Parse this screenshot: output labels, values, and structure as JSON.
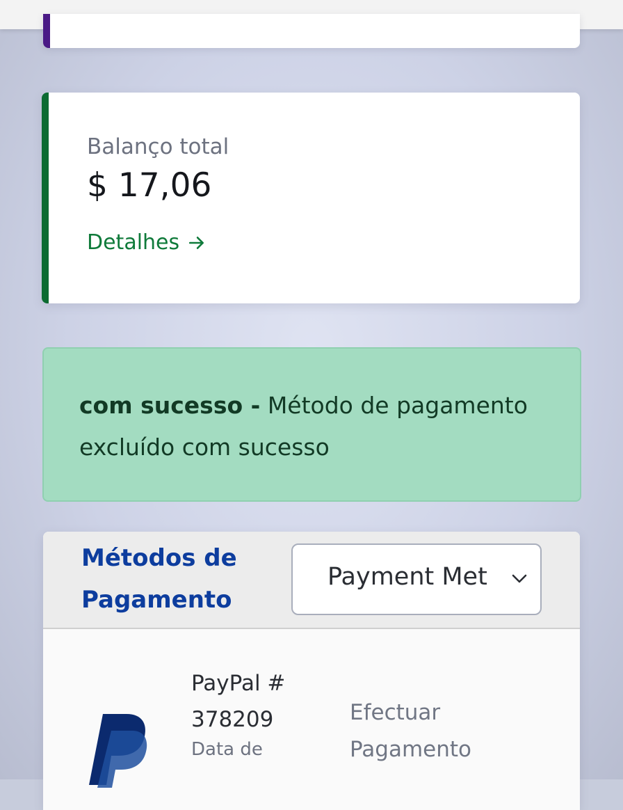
{
  "balance": {
    "label": "Balanço total",
    "amount": "$ 17,06",
    "details_link": "Detalhes"
  },
  "alert": {
    "title": "com sucesso -",
    "message": " Método de pagamento excluído com sucesso"
  },
  "payment_methods": {
    "title": "Métodos de Pagamento",
    "select_value": "Payment Methods",
    "items": [
      {
        "name": "PayPal # 378209",
        "date_label": "Data de",
        "action": "Efectuar Pagamento"
      }
    ]
  },
  "colors": {
    "accent_green": "#0c6b32",
    "alert_bg": "#a3dcc1",
    "link_blue": "#0d3d9e",
    "top_card_accent": "#4a1a86"
  }
}
